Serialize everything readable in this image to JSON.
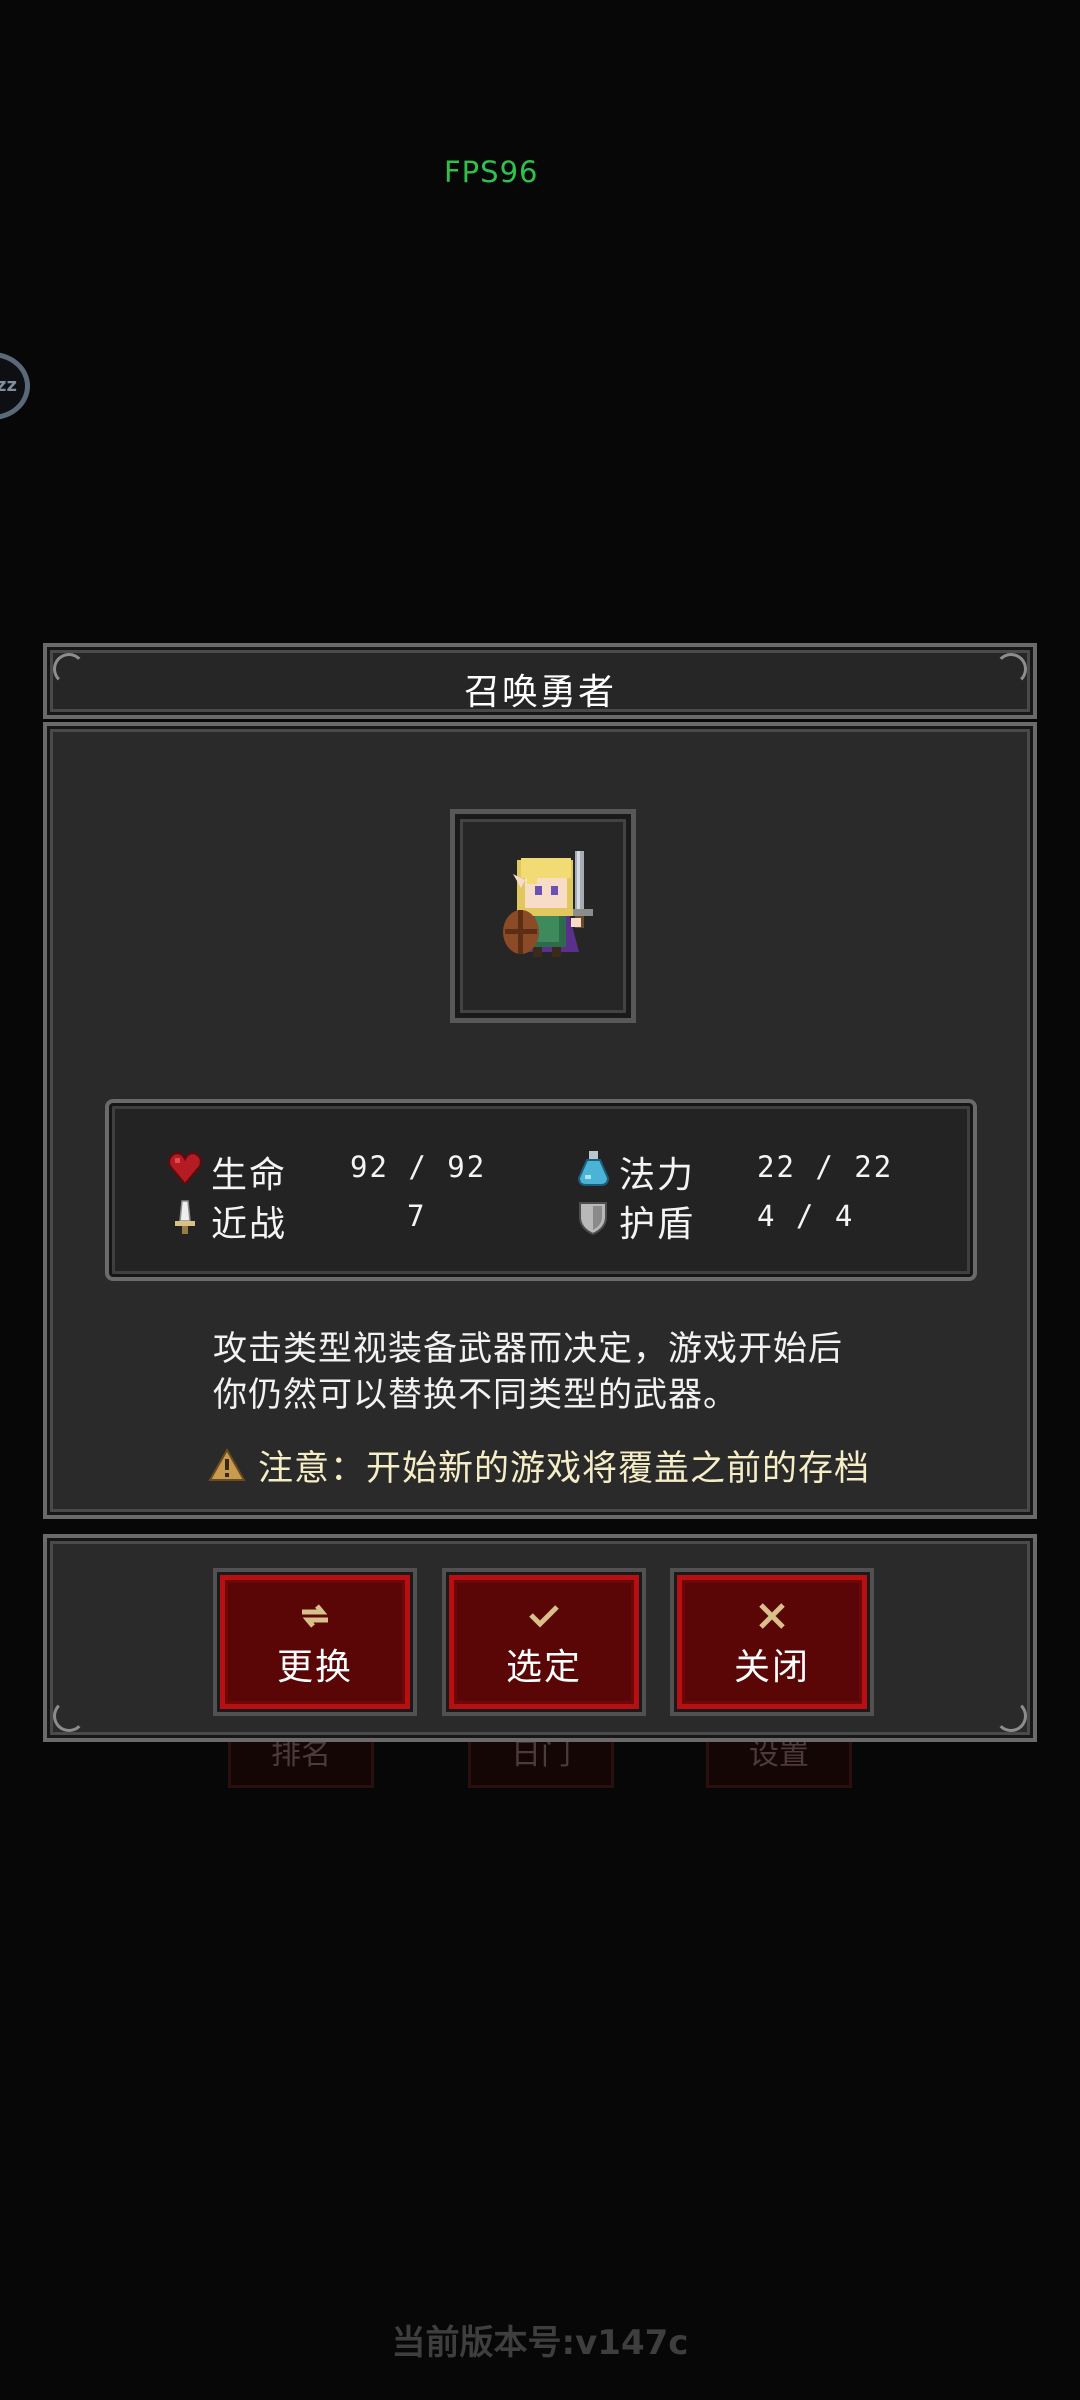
{
  "hud": {
    "fps": "FPS96",
    "side_badge": "zz"
  },
  "background_buttons": [
    "排名",
    "日门",
    "设置"
  ],
  "dialog": {
    "title": "召唤勇者",
    "stats": [
      {
        "icon": "heart-icon",
        "label": "生命",
        "value": "92 / 92"
      },
      {
        "icon": "mana-potion-icon",
        "label": "法力",
        "value": "22 / 22"
      },
      {
        "icon": "dagger-icon",
        "label": "近战",
        "value": "7"
      },
      {
        "icon": "shield-icon",
        "label": "护盾",
        "value": "4 / 4"
      }
    ],
    "description": [
      "攻击类型视装备武器而决定，游戏开始后",
      "你仍然可以替换不同类型的武器。"
    ],
    "warning": "注意：开始新的游戏将覆盖之前的存档",
    "buttons": [
      {
        "icon": "swap-icon",
        "label": "更换"
      },
      {
        "icon": "check-icon",
        "label": "选定"
      },
      {
        "icon": "close-icon",
        "label": "关闭"
      }
    ]
  },
  "footer": {
    "version": "当前版本号:v147c"
  },
  "colors": {
    "fps": "#2fc14b",
    "button_red": "#b70f12",
    "button_fill": "#5a0606",
    "panel": "#2a2a2a",
    "warning_text": "#f5edc6",
    "button_icon": "#d9c089"
  }
}
